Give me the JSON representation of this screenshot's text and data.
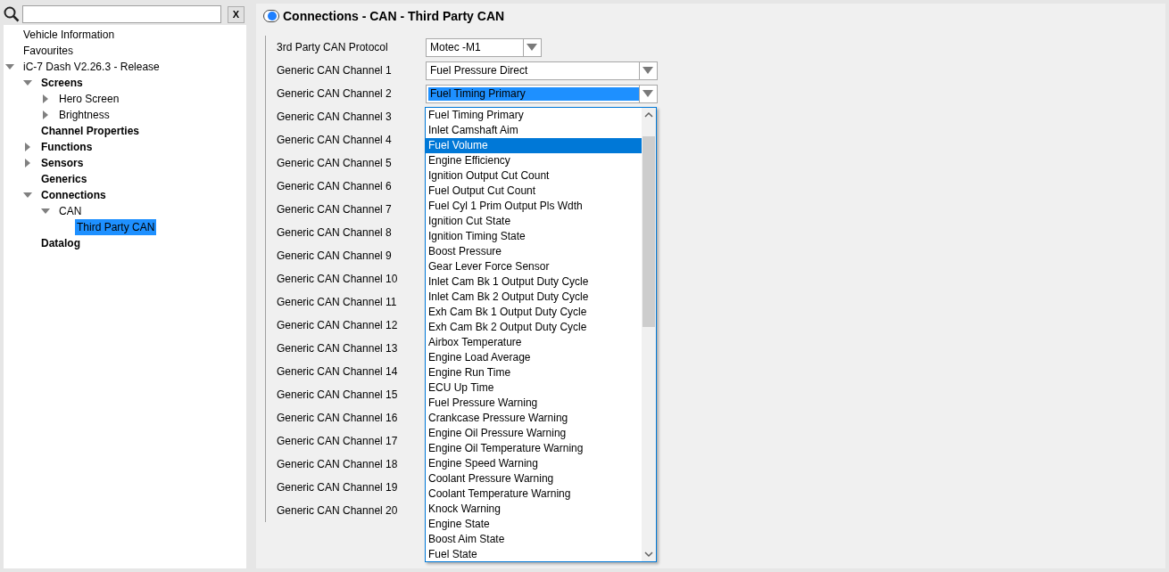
{
  "sidebar": {
    "search": {
      "clear_label": "X"
    },
    "tree": [
      {
        "label": "Vehicle Information",
        "selected": false
      },
      {
        "label": "Favourites",
        "selected": false
      },
      {
        "label": "iC-7 Dash V2.26.3 - Release",
        "selected": false,
        "expanded": true,
        "children": [
          {
            "label": "Screens",
            "selected": false,
            "expanded": true,
            "children": [
              {
                "label": "Hero Screen",
                "selected": false,
                "expanded": false
              },
              {
                "label": "Brightness",
                "selected": false,
                "expanded": false
              }
            ]
          },
          {
            "label": "Channel Properties",
            "selected": false
          },
          {
            "label": "Functions",
            "selected": false,
            "expanded": false
          },
          {
            "label": "Sensors",
            "selected": false,
            "expanded": false
          },
          {
            "label": "Generics",
            "selected": false
          },
          {
            "label": "Connections",
            "selected": false,
            "expanded": true,
            "children": [
              {
                "label": "CAN",
                "selected": false,
                "expanded": true,
                "children": [
                  {
                    "label": "Third Party CAN",
                    "selected": true
                  }
                ]
              }
            ]
          },
          {
            "label": "Datalog",
            "selected": false
          }
        ]
      }
    ]
  },
  "header": {
    "title": "Connections - CAN - Third Party CAN"
  },
  "form": {
    "rows": [
      {
        "label": "3rd Party CAN Protocol",
        "kind": "short",
        "value": "Motec -M1",
        "focused": false
      },
      {
        "label": "Generic CAN Channel 1",
        "kind": "long",
        "value": "Fuel Pressure Direct",
        "focused": false
      },
      {
        "label": "Generic CAN Channel 2",
        "kind": "long",
        "value": "Fuel Timing Primary",
        "focused": true
      },
      {
        "label": "Generic CAN Channel 3",
        "kind": "hidden"
      },
      {
        "label": "Generic CAN Channel 4",
        "kind": "hidden"
      },
      {
        "label": "Generic CAN Channel 5",
        "kind": "hidden"
      },
      {
        "label": "Generic CAN Channel 6",
        "kind": "hidden"
      },
      {
        "label": "Generic CAN Channel 7",
        "kind": "hidden"
      },
      {
        "label": "Generic CAN Channel 8",
        "kind": "hidden"
      },
      {
        "label": "Generic CAN Channel 9",
        "kind": "hidden"
      },
      {
        "label": "Generic CAN Channel 10",
        "kind": "hidden"
      },
      {
        "label": "Generic CAN Channel 11",
        "kind": "hidden"
      },
      {
        "label": "Generic CAN Channel 12",
        "kind": "hidden"
      },
      {
        "label": "Generic CAN Channel 13",
        "kind": "hidden"
      },
      {
        "label": "Generic CAN Channel 14",
        "kind": "hidden"
      },
      {
        "label": "Generic CAN Channel 15",
        "kind": "hidden"
      },
      {
        "label": "Generic CAN Channel 16",
        "kind": "hidden"
      },
      {
        "label": "Generic CAN Channel 17",
        "kind": "hidden"
      },
      {
        "label": "Generic CAN Channel 18",
        "kind": "hidden"
      },
      {
        "label": "Generic CAN Channel 19",
        "kind": "hidden"
      },
      {
        "label": "Generic CAN Channel 20",
        "kind": "hidden"
      }
    ],
    "dropdown_list": [
      {
        "label": "Fuel Timing Primary",
        "selected": false
      },
      {
        "label": "Inlet Camshaft Aim",
        "selected": false
      },
      {
        "label": "Fuel Volume",
        "selected": true
      },
      {
        "label": "Engine Efficiency",
        "selected": false
      },
      {
        "label": "Ignition Output Cut Count",
        "selected": false
      },
      {
        "label": "Fuel Output Cut Count",
        "selected": false
      },
      {
        "label": "Fuel Cyl 1 Prim Output Pls Wdth",
        "selected": false
      },
      {
        "label": "Ignition Cut State",
        "selected": false
      },
      {
        "label": "Ignition Timing State",
        "selected": false
      },
      {
        "label": "Boost Pressure",
        "selected": false
      },
      {
        "label": "Gear Lever Force Sensor",
        "selected": false
      },
      {
        "label": "Inlet Cam Bk 1 Output Duty Cycle",
        "selected": false
      },
      {
        "label": "Inlet Cam Bk 2 Output Duty Cycle",
        "selected": false
      },
      {
        "label": "Exh Cam Bk 1 Output Duty Cycle",
        "selected": false
      },
      {
        "label": "Exh Cam Bk 2 Output Duty Cycle",
        "selected": false
      },
      {
        "label": "Airbox Temperature",
        "selected": false
      },
      {
        "label": "Engine Load Average",
        "selected": false
      },
      {
        "label": "Engine Run Time",
        "selected": false
      },
      {
        "label": "ECU Up Time",
        "selected": false
      },
      {
        "label": "Fuel Pressure Warning",
        "selected": false
      },
      {
        "label": "Crankcase Pressure Warning",
        "selected": false
      },
      {
        "label": "Engine Oil Pressure Warning",
        "selected": false
      },
      {
        "label": "Engine Oil Temperature Warning",
        "selected": false
      },
      {
        "label": "Engine Speed Warning",
        "selected": false
      },
      {
        "label": "Coolant Pressure Warning",
        "selected": false
      },
      {
        "label": "Coolant Temperature Warning",
        "selected": false
      },
      {
        "label": "Knock Warning",
        "selected": false
      },
      {
        "label": "Engine State",
        "selected": false
      },
      {
        "label": "Boost Aim State",
        "selected": false
      },
      {
        "label": "Fuel State",
        "selected": false
      }
    ]
  }
}
